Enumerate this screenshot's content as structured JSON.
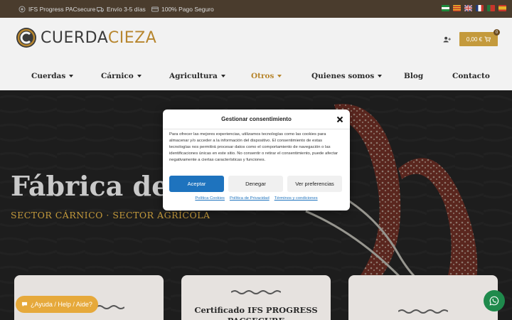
{
  "topbar": {
    "items": [
      {
        "icon": "certificate-icon",
        "label": "IFS Progress PACsecure"
      },
      {
        "icon": "truck-icon",
        "label": "Envío 3-5 días"
      },
      {
        "icon": "credit-card-icon",
        "label": "100% Pago Seguro"
      }
    ],
    "flags": [
      "flag-andalucia",
      "flag-catalonia",
      "flag-uk",
      "flag-france",
      "flag-portugal",
      "flag-spain"
    ]
  },
  "header": {
    "logo_part1": "CUERDA",
    "logo_part2": "CIEZA",
    "cart_total": "0,00 €",
    "cart_count": "0"
  },
  "nav": {
    "items": [
      {
        "label": "Cuerdas",
        "dropdown": true
      },
      {
        "label": "Cárnico",
        "dropdown": true
      },
      {
        "label": "Agricultura",
        "dropdown": true
      },
      {
        "label": "Otros",
        "dropdown": true,
        "active": true
      },
      {
        "label": "Quienes somos",
        "dropdown": true
      },
      {
        "label": "Blog",
        "dropdown": false
      },
      {
        "label": "Contacto",
        "dropdown": false
      }
    ]
  },
  "hero": {
    "title": "Fábrica de g",
    "subtitle": "SECTOR CÁRNICO · SECTOR AGRÍCOLA"
  },
  "cards": [
    {
      "title": ""
    },
    {
      "title": "Certificado IFS PROGRESS PACSECURE"
    },
    {
      "title": ""
    }
  ],
  "help_button": "¿Ayuda / Help / Aide?",
  "modal": {
    "title": "Gestionar consentimiento",
    "body": "Para ofrecer las mejores experiencias, utilizamos tecnologías como las cookies para almacenar y/o acceder a la información del dispositivo. El consentimiento de estas tecnologías nos permitirá procesar datos como el comportamiento de navegación o las identificaciones únicas en este sitio. No consentir o retirar el consentimiento, puede afectar negativamente a ciertas características y funciones.",
    "accept": "Aceptar",
    "deny": "Denegar",
    "preferences": "Ver preferencias",
    "links": [
      "Política Cookies",
      "Política de Privacidad",
      "Términos y condiciones"
    ]
  },
  "colors": {
    "topbar": "#4a3c2d",
    "gold": "#c49a3c",
    "accept_blue": "#1e73be",
    "help_orange": "#e6a93b",
    "whatsapp_green": "#1f8a4c"
  }
}
